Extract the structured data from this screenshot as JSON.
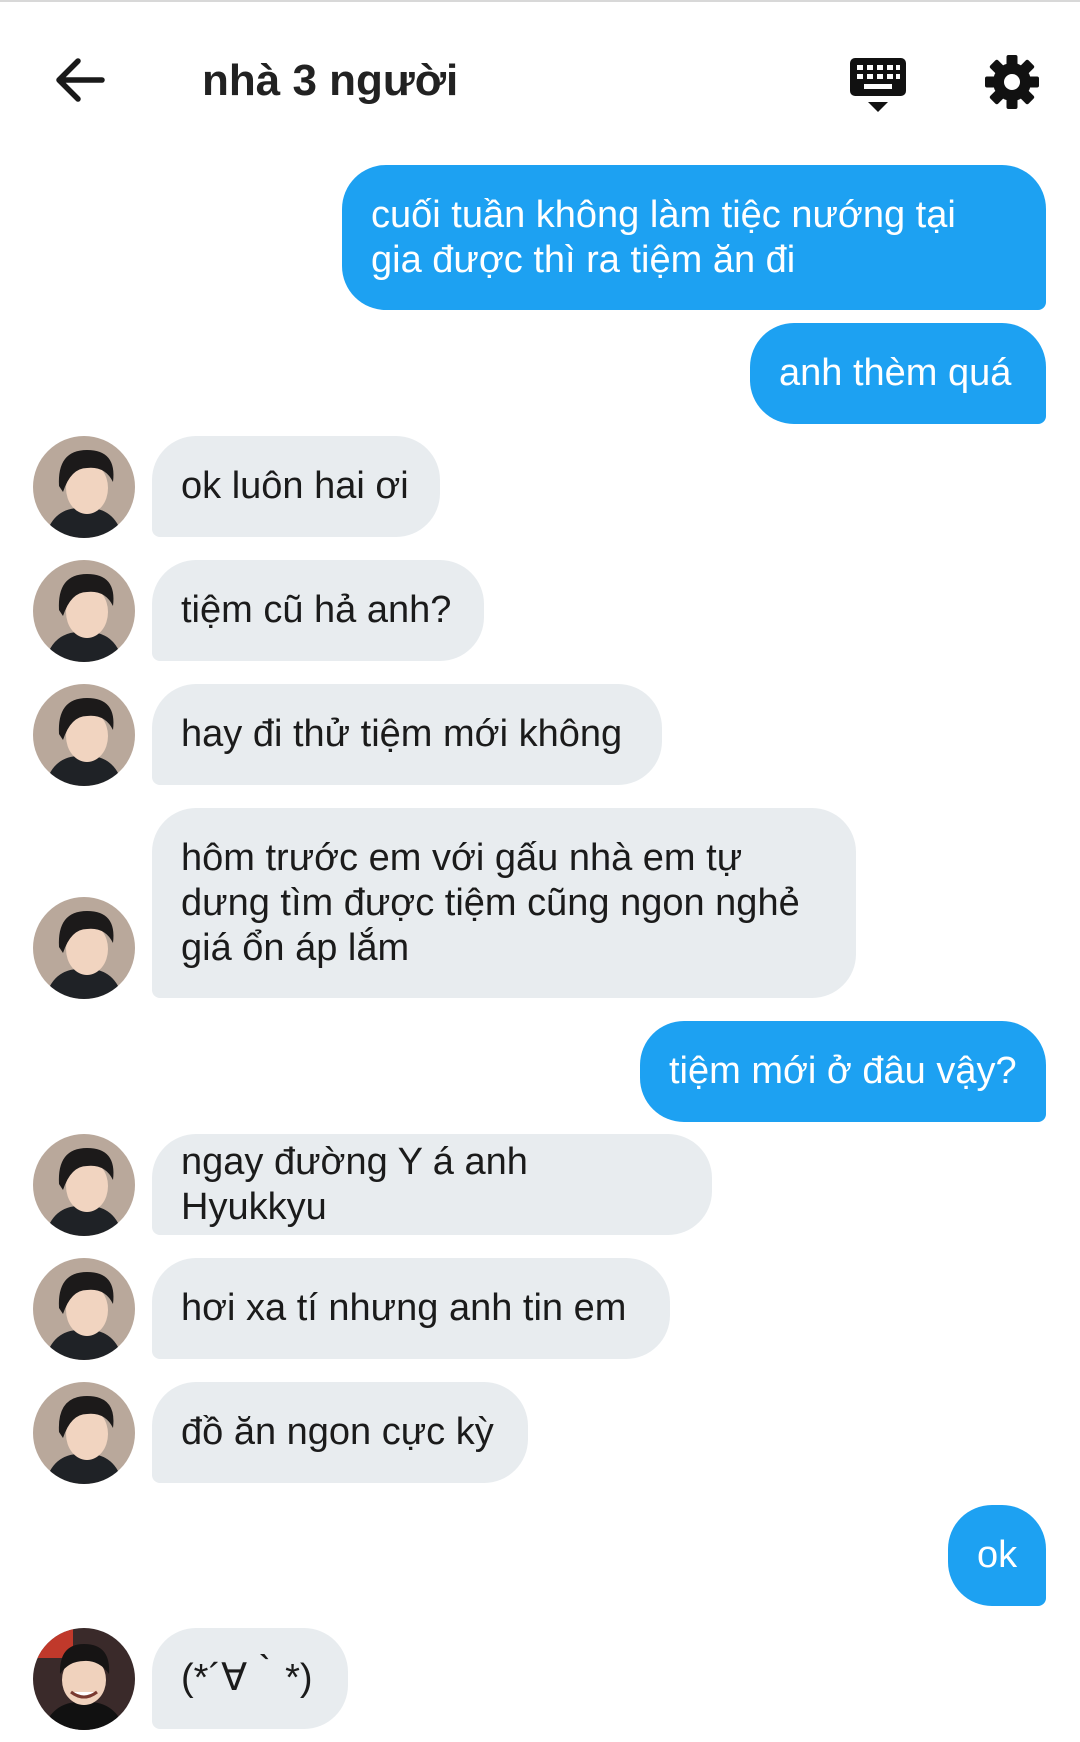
{
  "header": {
    "title": "nhà 3 người",
    "back_icon": "arrow-left-icon",
    "keyboard_icon": "keyboard-icon",
    "settings_icon": "gear-icon"
  },
  "colors": {
    "outgoing": "#1da1f2",
    "incoming": "#e8ecef",
    "outgoing_text": "#ffffff",
    "incoming_text": "#1b1b1b"
  },
  "messages": [
    {
      "side": "out",
      "text": "cuối tuần không làm tiệc nướng tại\ngia được thì ra tiệm ăn đi"
    },
    {
      "side": "out",
      "text": "anh thèm quá"
    },
    {
      "side": "in",
      "avatar": "avatar-a",
      "text": "ok luôn hai ơi"
    },
    {
      "side": "in",
      "avatar": "avatar-a",
      "text": "tiệm cũ hả anh?"
    },
    {
      "side": "in",
      "avatar": "avatar-a",
      "text": "hay đi thử tiệm mới không"
    },
    {
      "side": "in",
      "avatar": "avatar-a",
      "text": "hôm trước em với gấu nhà em tự\ndưng tìm được tiệm cũng ngon nghẻ\ngiá ổn áp lắm"
    },
    {
      "side": "out",
      "text": "tiệm mới ở đâu vậy?"
    },
    {
      "side": "in",
      "avatar": "avatar-a",
      "text": "ngay đường Y á anh Hyukkyu"
    },
    {
      "side": "in",
      "avatar": "avatar-a",
      "text": "hơi xa tí nhưng anh tin em"
    },
    {
      "side": "in",
      "avatar": "avatar-a",
      "text": "đồ ăn ngon cực kỳ"
    },
    {
      "side": "out",
      "text": "ok"
    },
    {
      "side": "in",
      "avatar": "avatar-b",
      "text": "(*´∀｀*)"
    }
  ]
}
